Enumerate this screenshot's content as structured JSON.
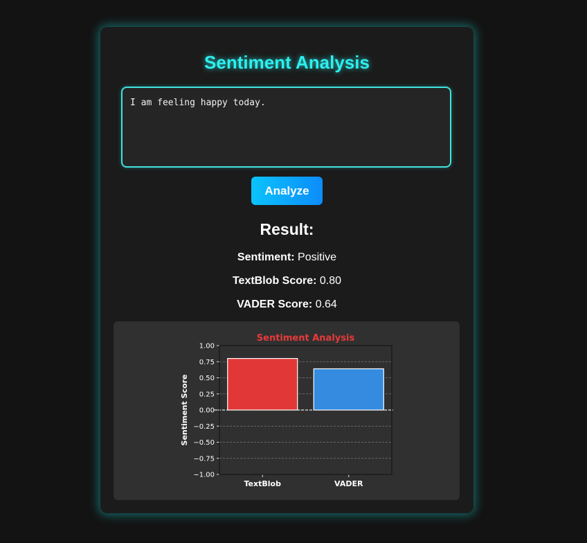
{
  "app": {
    "title": "Sentiment Analysis"
  },
  "input": {
    "value": "I am feeling happy today."
  },
  "analyze_button": {
    "label": "Analyze"
  },
  "result": {
    "heading": "Result:",
    "sentiment_label": "Sentiment:",
    "sentiment_value": "Positive",
    "textblob_label": "TextBlob Score:",
    "textblob_value": "0.80",
    "vader_label": "VADER Score:",
    "vader_value": "0.64"
  },
  "chart_data": {
    "type": "bar",
    "title": "Sentiment Analysis",
    "xlabel": "",
    "ylabel": "Sentiment Score",
    "categories": [
      "TextBlob",
      "VADER"
    ],
    "values": [
      0.8,
      0.64
    ],
    "colors": [
      "#e23737",
      "#348be0"
    ],
    "ylim": [
      -1.0,
      1.0
    ],
    "yticks": [
      "1.00",
      "0.75",
      "0.50",
      "0.25",
      "0.00",
      "−0.25",
      "−0.50",
      "−0.75",
      "−1.00"
    ],
    "grid": "horizontal dashed",
    "title_color": "#e83a3a"
  },
  "colors": {
    "accent": "#2cf0ee",
    "button": "#0d8cfa",
    "background": "#131313",
    "card": "#1b1b1b",
    "panel": "#303030"
  }
}
